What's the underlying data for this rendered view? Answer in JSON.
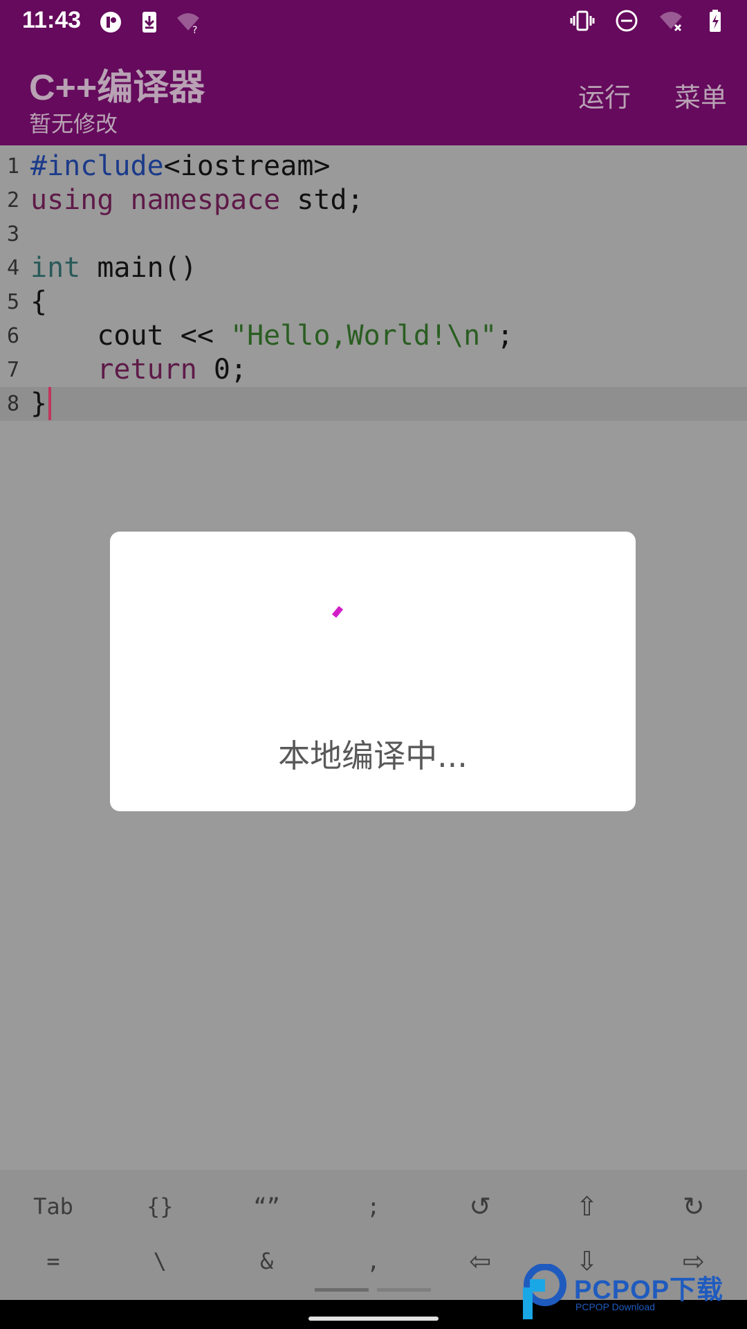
{
  "status_bar": {
    "time": "11:43",
    "left_icons": [
      "app-notification-icon",
      "download-icon",
      "wifi-question-icon"
    ],
    "right_icons": [
      "vibrate-icon",
      "do-not-disturb-icon",
      "wifi-off-icon",
      "battery-charging-icon"
    ]
  },
  "app_bar": {
    "title": "C++编译器",
    "subtitle": "暂无修改",
    "actions": {
      "run": "运行",
      "menu": "菜单"
    }
  },
  "editor": {
    "lines": [
      {
        "n": "1",
        "parts": [
          {
            "t": "#include",
            "c": "kw-dir"
          },
          {
            "t": "<iostream>",
            "c": ""
          }
        ]
      },
      {
        "n": "2",
        "parts": [
          {
            "t": "using",
            "c": "kw"
          },
          {
            "t": " ",
            "c": ""
          },
          {
            "t": "namespace",
            "c": "kw"
          },
          {
            "t": " std;",
            "c": ""
          }
        ]
      },
      {
        "n": "3",
        "parts": []
      },
      {
        "n": "4",
        "parts": [
          {
            "t": "int",
            "c": "kw-type"
          },
          {
            "t": " main()",
            "c": ""
          }
        ]
      },
      {
        "n": "5",
        "parts": [
          {
            "t": "{",
            "c": ""
          }
        ]
      },
      {
        "n": "6",
        "parts": [
          {
            "t": "    cout << ",
            "c": ""
          },
          {
            "t": "\"Hello,World!\\n\"",
            "c": "str"
          },
          {
            "t": ";",
            "c": ""
          }
        ]
      },
      {
        "n": "7",
        "parts": [
          {
            "t": "    ",
            "c": ""
          },
          {
            "t": "return",
            "c": "kw"
          },
          {
            "t": " 0;",
            "c": ""
          }
        ]
      },
      {
        "n": "8",
        "parts": [
          {
            "t": "}",
            "c": ""
          }
        ]
      }
    ],
    "current_line": 8
  },
  "dialog": {
    "message": "本地编译中...",
    "spinner_color": "#d21ec8"
  },
  "keybar": {
    "row1": [
      "Tab",
      "{}",
      "“”",
      ";",
      "↺",
      "⇧",
      "↻"
    ],
    "row2": [
      "=",
      "\\",
      "&",
      ",",
      "⇦",
      "⇩",
      "⇨"
    ]
  },
  "watermark": {
    "brand": "PCPOP下载",
    "sub": "PCPOP Download"
  },
  "colors": {
    "primary": "#650a5c",
    "overlay_bg": "#9a9a9a",
    "cursor": "#c1355e"
  }
}
